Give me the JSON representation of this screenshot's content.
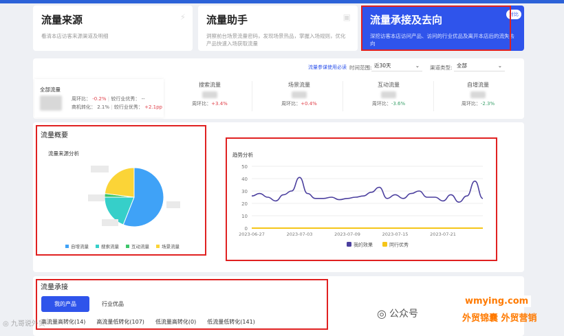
{
  "nav_cards": [
    {
      "title": "流量来源",
      "desc": "看清本店访客来源渠道及明细"
    },
    {
      "title": "流量助手",
      "desc": "洞察前台场景流量密码，发现场景热品，掌握入场规则，优化产品快速入场获取流量"
    },
    {
      "title": "流量承接及去向",
      "desc": "深挖访客本店访问产品、访问的行业优品及离开本店后的流失去向",
      "badge": "对比"
    }
  ],
  "filters": {
    "link": "流量参谋使用必读",
    "time_label": "时间范围:",
    "time_value": "近30天",
    "channel_label": "渠道类型:",
    "channel_value": "全部"
  },
  "overview": {
    "all": {
      "label": "全部流量",
      "ring_label": "周环比：",
      "ring_value": "-0.2%",
      "ring_peer_label": "较行业优秀：",
      "ring_peer_value": "--",
      "conv_label": "商机转化：",
      "conv_value": "2.1%",
      "conv_peer_label": "较行业优秀：",
      "conv_peer_value": "+2.1pp"
    },
    "metrics": [
      {
        "name": "搜索流量",
        "ring_label": "周环比：",
        "ring_value": "+3.4%"
      },
      {
        "name": "场景流量",
        "ring_label": "周环比：",
        "ring_value": "+0.4%"
      },
      {
        "name": "互动流量",
        "ring_label": "周环比：",
        "ring_value": "-3.6%"
      },
      {
        "name": "自增流量",
        "ring_label": "周环比：",
        "ring_value": "-2.3%"
      }
    ]
  },
  "summary": {
    "title": "流量概要",
    "pie_title": "流量来源分析",
    "trend_title": "趋势分析"
  },
  "chart_data": [
    {
      "type": "pie",
      "title": "流量来源分析",
      "categories": [
        "自增流量",
        "搜索流量",
        "互动流量",
        "场景流量"
      ],
      "values": [
        56,
        19,
        2,
        23
      ],
      "colors": [
        "#3fa2f7",
        "#36cfc9",
        "#3ec66a",
        "#fbd437"
      ]
    },
    {
      "type": "line",
      "title": "趋势分析",
      "x": [
        "2023-06-27",
        "2023-06-28",
        "2023-06-29",
        "2023-06-30",
        "2023-07-01",
        "2023-07-02",
        "2023-07-03",
        "2023-07-04",
        "2023-07-05",
        "2023-07-06",
        "2023-07-07",
        "2023-07-08",
        "2023-07-09",
        "2023-07-10",
        "2023-07-11",
        "2023-07-12",
        "2023-07-13",
        "2023-07-14",
        "2023-07-15",
        "2023-07-16",
        "2023-07-17",
        "2023-07-18",
        "2023-07-19",
        "2023-07-20",
        "2023-07-21",
        "2023-07-22",
        "2023-07-23",
        "2023-07-24",
        "2023-07-25",
        "2023-07-26"
      ],
      "x_ticks": [
        "2023-06-27",
        "2023-07-03",
        "2023-07-09",
        "2023-07-15",
        "2023-07-21"
      ],
      "ylim": [
        0,
        50
      ],
      "y_ticks": [
        0,
        10,
        20,
        30,
        40,
        50
      ],
      "series": [
        {
          "name": "我的效果",
          "color": "#4b3f9e",
          "values": [
            26,
            28,
            25,
            22,
            27,
            30,
            41,
            28,
            24,
            24,
            25,
            23,
            24,
            25,
            26,
            29,
            33,
            24,
            27,
            24,
            28,
            30,
            25,
            25,
            22,
            27,
            21,
            26,
            38,
            24
          ]
        },
        {
          "name": "同行优秀",
          "color": "#f5c518",
          "values": [
            0,
            0,
            0,
            0,
            0,
            0,
            0,
            0,
            0,
            0,
            0,
            0,
            0,
            0,
            0,
            0,
            0,
            0,
            0,
            0,
            0,
            0,
            0,
            0,
            0,
            0,
            0,
            0,
            0,
            0
          ]
        }
      ]
    }
  ],
  "flow": {
    "title": "流量承接",
    "tabs": [
      "我的产品",
      "行业优品"
    ],
    "subtabs": [
      "高流量高转化(14)",
      "高流量低转化(107)",
      "低流量高转化(0)",
      "低流量低转化(141)"
    ]
  },
  "watermark": {
    "wechat": "公众号",
    "brand": "外贸锦囊 外贸营销",
    "site": "wmying.com",
    "left": "九哥说外贸"
  }
}
